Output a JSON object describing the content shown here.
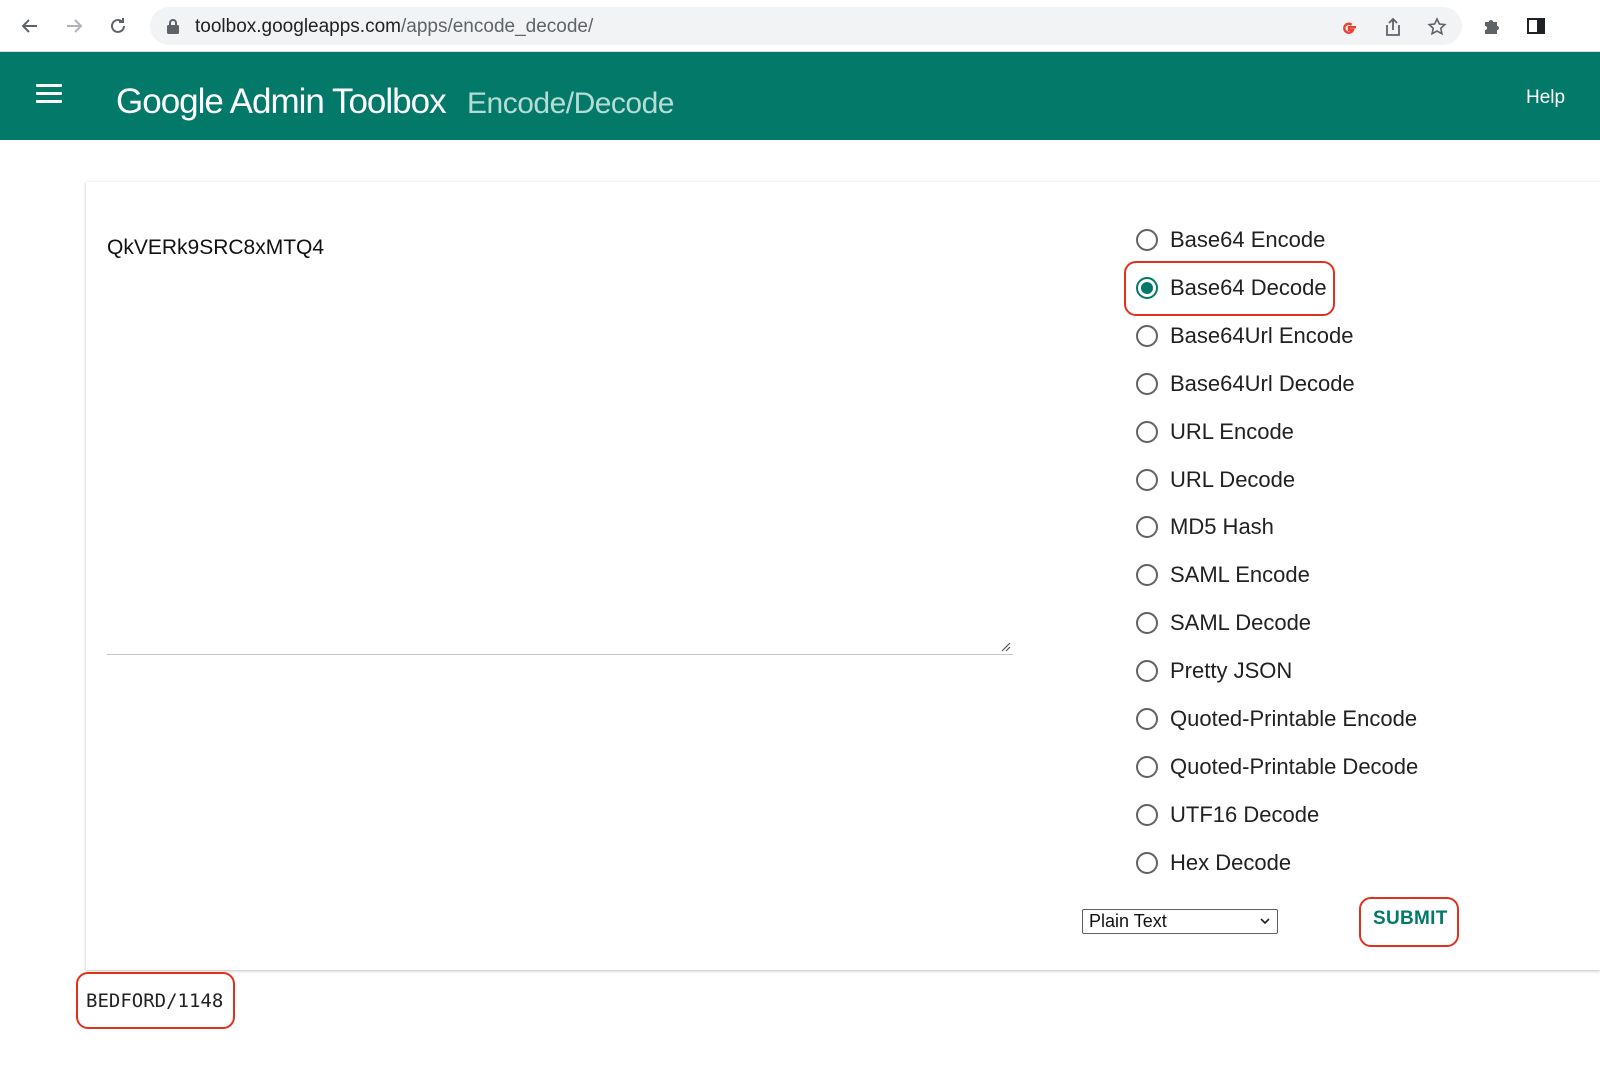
{
  "browser": {
    "url_host": "toolbox.googleapps.com",
    "url_path": "/apps/encode_decode/"
  },
  "header": {
    "brand": "Google Admin Toolbox",
    "subtitle": "Encode/Decode",
    "help_label": "Help"
  },
  "input": {
    "value": "QkVERk9SRC8xMTQ4"
  },
  "options": [
    {
      "label": "Base64 Encode",
      "checked": false
    },
    {
      "label": "Base64 Decode",
      "checked": true
    },
    {
      "label": "Base64Url Encode",
      "checked": false
    },
    {
      "label": "Base64Url Decode",
      "checked": false
    },
    {
      "label": "URL Encode",
      "checked": false
    },
    {
      "label": "URL Decode",
      "checked": false
    },
    {
      "label": "MD5 Hash",
      "checked": false
    },
    {
      "label": "SAML Encode",
      "checked": false
    },
    {
      "label": "SAML Decode",
      "checked": false
    },
    {
      "label": "Pretty JSON",
      "checked": false
    },
    {
      "label": "Quoted-Printable Encode",
      "checked": false
    },
    {
      "label": "Quoted-Printable Decode",
      "checked": false
    },
    {
      "label": "UTF16 Decode",
      "checked": false
    },
    {
      "label": "Hex Decode",
      "checked": false
    }
  ],
  "format_select": {
    "selected": "Plain Text"
  },
  "submit_label": "SUBMIT",
  "output": {
    "value": "BEDFORD/1148"
  },
  "colors": {
    "appbar": "#03796a",
    "accent": "#03796a",
    "highlight": "#e0301e"
  }
}
